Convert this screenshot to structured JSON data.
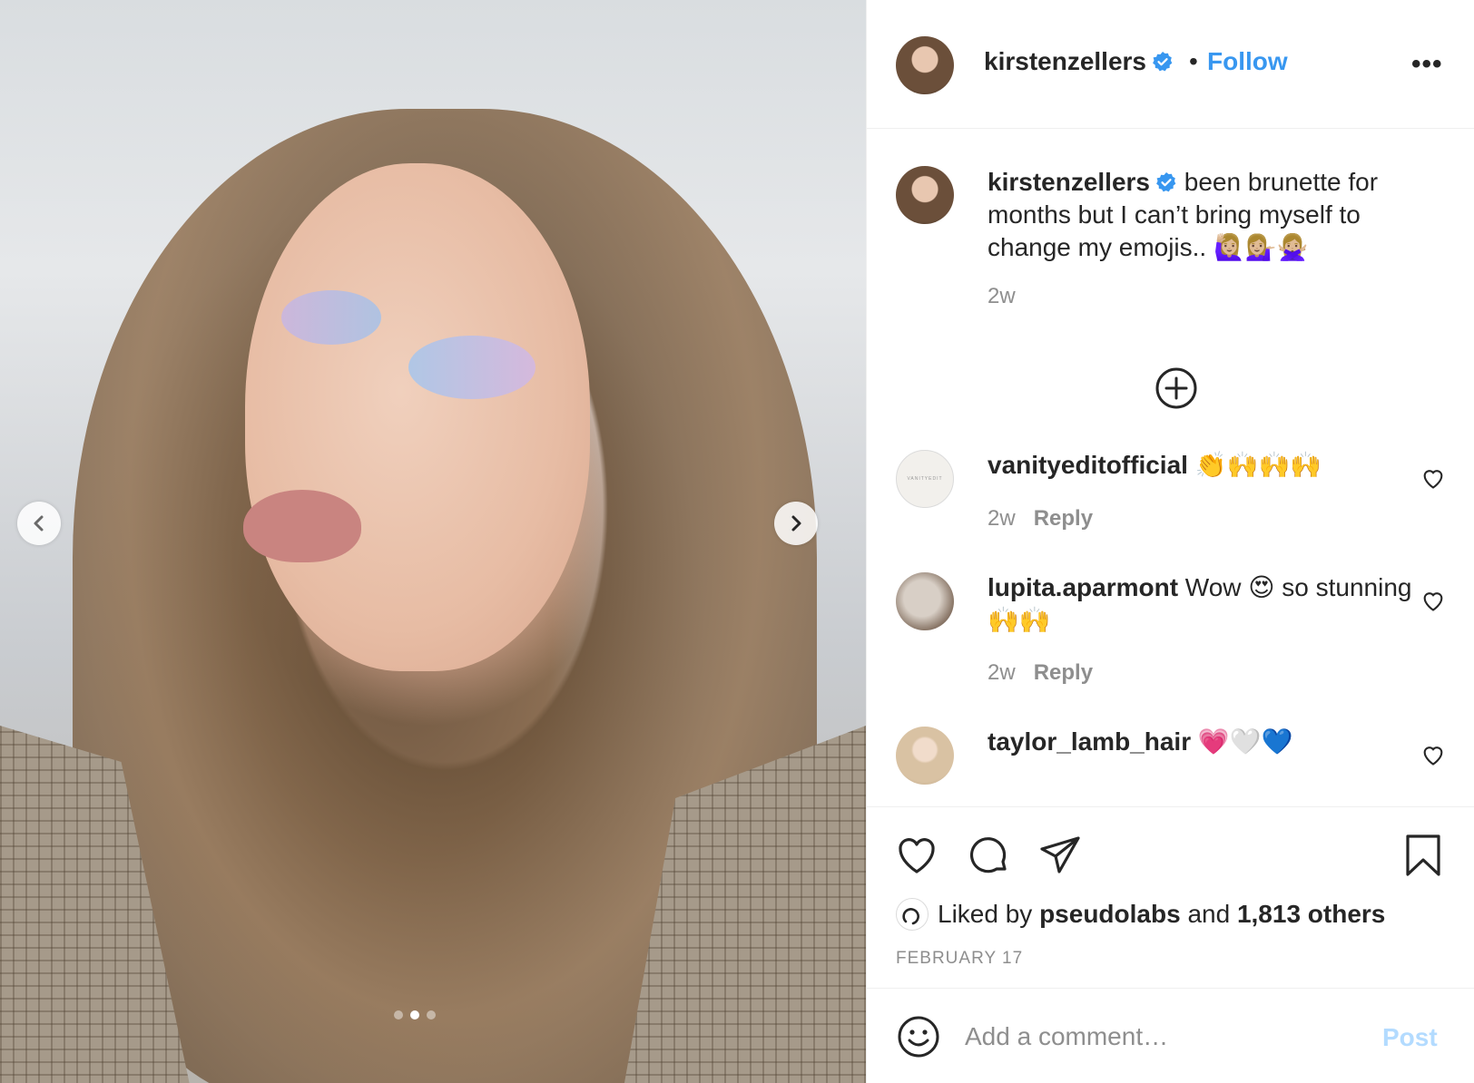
{
  "post": {
    "username": "kirstenzellers",
    "follow_label": "Follow",
    "dot": "•",
    "more_label": "•••"
  },
  "caption": {
    "username": "kirstenzellers",
    "text": "been brunette for months but I can’t bring myself to change my emojis..",
    "emojis": "🙋🏼‍♀️💁🏼‍♀️🙅🏼‍♀️",
    "time": "2w"
  },
  "comments": [
    {
      "username": "vanityeditofficial",
      "text": "",
      "emojis": "👏🙌🙌🙌",
      "time": "2w",
      "reply_label": "Reply",
      "avatar_text": "VANITYEDIT"
    },
    {
      "username": "lupita.aparmont",
      "text": "Wow",
      "emoji_mid": "😍",
      "text2": "so stunning",
      "emojis": "🙌🙌",
      "time": "2w",
      "reply_label": "Reply"
    },
    {
      "username": "taylor_lamb_hair",
      "text": "",
      "emojis": "💗🤍💙"
    }
  ],
  "likes": {
    "prefix": "Liked by",
    "user": "pseudolabs",
    "middle": "and",
    "others": "1,813 others"
  },
  "date": "FEBRUARY 17",
  "add_comment": {
    "placeholder": "Add a comment…",
    "post_label": "Post"
  },
  "carousel": {
    "total": 3,
    "active_index": 1
  },
  "colors": {
    "link": "#3897f0",
    "verified": "#3897f0",
    "post_disabled": "#b3dbff",
    "muted": "#8e8e8e"
  }
}
